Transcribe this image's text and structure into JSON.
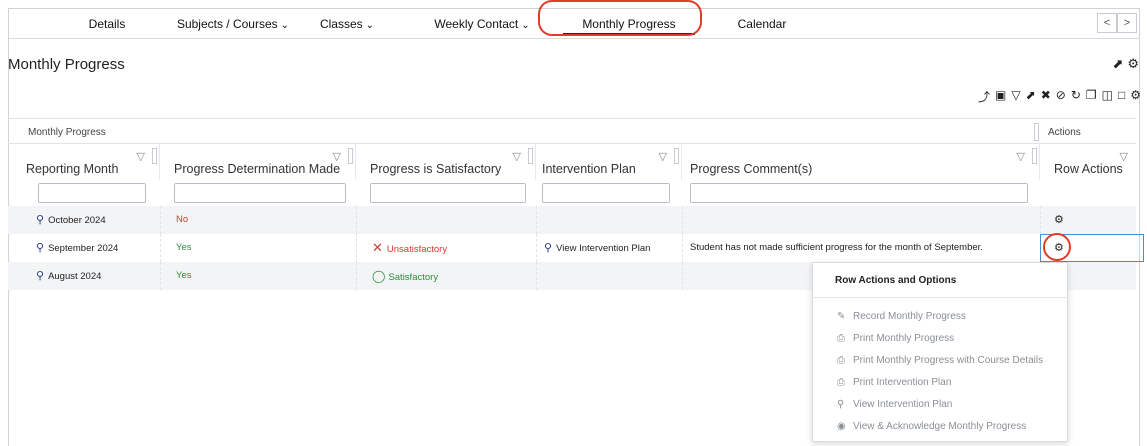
{
  "nav": {
    "tabs": [
      {
        "label": "Details",
        "chevron": false
      },
      {
        "label": "Subjects / Courses",
        "chevron": true
      },
      {
        "label": "Classes",
        "chevron": true
      },
      {
        "label": "Weekly Contact",
        "chevron": true
      },
      {
        "label": "Monthly Progress",
        "chevron": false,
        "active": true
      },
      {
        "label": "Calendar",
        "chevron": false
      }
    ],
    "prev": "<",
    "next": ">"
  },
  "page": {
    "title": "Monthly Progress"
  },
  "grid": {
    "group_headers": {
      "main": "Monthly Progress",
      "actions": "Actions"
    },
    "columns": [
      "Reporting Month",
      "Progress Determination Made",
      "Progress is Satisfactory",
      "Intervention Plan",
      "Progress Comment(s)",
      "Row Actions"
    ],
    "rows": [
      {
        "month": "October 2024",
        "determination": "No",
        "satisfactory": "",
        "plan": "",
        "comment": ""
      },
      {
        "month": "September 2024",
        "determination": "Yes",
        "satisfactory": "Unsatisfactory",
        "plan": "View Intervention Plan",
        "comment": "Student has not made sufficient progress for the month of September."
      },
      {
        "month": "August 2024",
        "determination": "Yes",
        "satisfactory": "Satisfactory",
        "plan": "",
        "comment": ""
      }
    ]
  },
  "row_actions": {
    "title": "Row Actions and Options",
    "items": [
      {
        "label": "Record Monthly Progress",
        "icon": "edit-icon"
      },
      {
        "label": "Print Monthly Progress",
        "icon": "print-icon"
      },
      {
        "label": "Print Monthly Progress with Course Details",
        "icon": "print-icon"
      },
      {
        "label": "Print Intervention Plan",
        "icon": "print-icon"
      },
      {
        "label": "View Intervention Plan",
        "icon": "search-icon"
      },
      {
        "label": "View & Acknowledge Monthly Progress",
        "icon": "eye-icon"
      }
    ]
  },
  "colors": {
    "accent_red": "#e23b2a",
    "no_red": "#d23b2b",
    "yes_green": "#2e8b3a",
    "link_blue": "#2b3a8c"
  }
}
